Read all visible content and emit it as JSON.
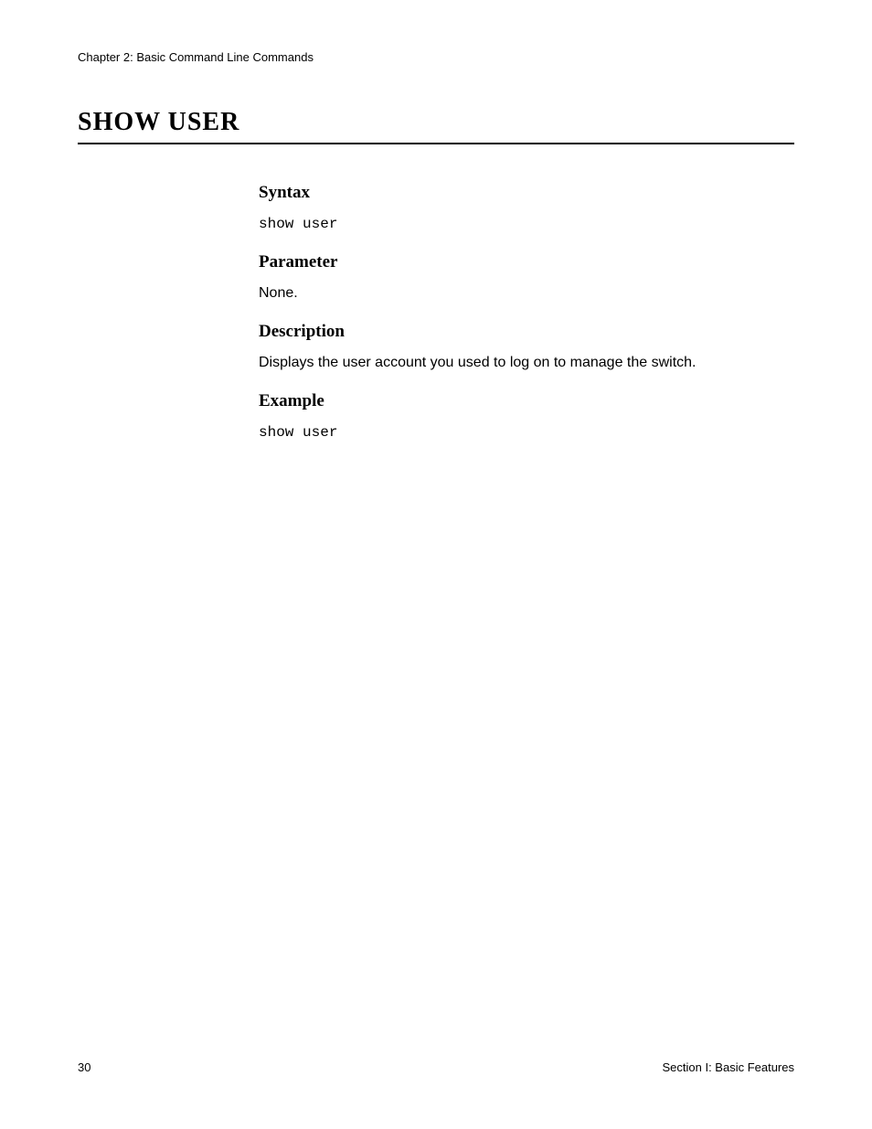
{
  "header": {
    "chapter": "Chapter 2: Basic Command Line Commands"
  },
  "title": "SHOW USER",
  "sections": {
    "syntax": {
      "heading": "Syntax",
      "text": "show user"
    },
    "parameter": {
      "heading": "Parameter",
      "text": "None."
    },
    "description": {
      "heading": "Description",
      "text": "Displays the user account you used to log on to manage the switch."
    },
    "example": {
      "heading": "Example",
      "text": "show user"
    }
  },
  "footer": {
    "page": "30",
    "section": "Section I: Basic Features"
  }
}
